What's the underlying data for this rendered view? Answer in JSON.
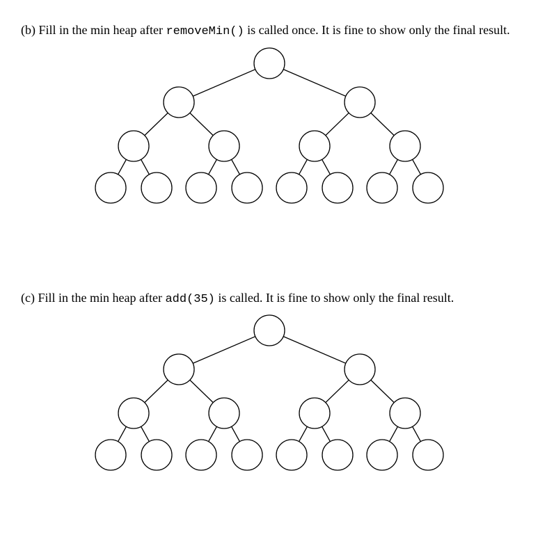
{
  "partB": {
    "label": "(b)",
    "text_before_code": "Fill in the min heap after ",
    "code": "removeMin()",
    "text_after_code": " is called once. It is fine to show only the final result."
  },
  "partC": {
    "label": "(c)",
    "text_before_code": "Fill in the min heap after ",
    "code": "add(35)",
    "text_after_code": " is called. It is fine to show only the final result."
  },
  "tree": {
    "levels": 4,
    "node_values": {
      "root": "",
      "l2": [
        "",
        ""
      ],
      "l3": [
        "",
        "",
        "",
        ""
      ],
      "l4": [
        "",
        "",
        "",
        "",
        "",
        "",
        "",
        ""
      ]
    }
  }
}
